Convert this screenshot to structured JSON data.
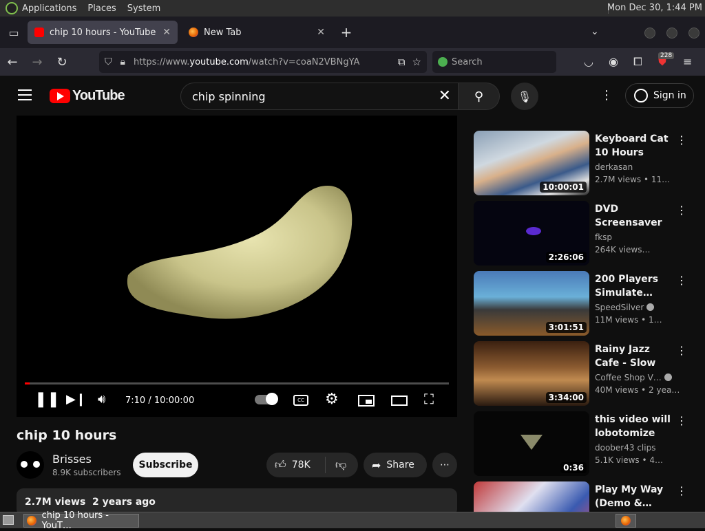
{
  "system_panel": {
    "menus": [
      "Applications",
      "Places",
      "System"
    ],
    "clock": "Mon Dec 30,  1:44 PM"
  },
  "browser": {
    "tabs": [
      {
        "title": "chip 10 hours - YouTube",
        "active": true
      },
      {
        "title": "New Tab",
        "active": false
      }
    ],
    "url_prefix": "https://www.",
    "url_domain": "youtube.com",
    "url_path": "/watch?v=coaN2VBNgYA",
    "search_placeholder": "Search",
    "extension_badge": "228"
  },
  "youtube": {
    "logo_text": "YouTube",
    "search_value": "chip spinning",
    "sign_in_label": "Sign in"
  },
  "player": {
    "time_display": "7:10 / 10:00:00",
    "progress_fraction": 0.0119
  },
  "video": {
    "title": "chip 10 hours",
    "channel": "Brisses",
    "subscribers": "8.9K subscribers",
    "subscribe_label": "Subscribe",
    "likes": "78K",
    "share_label": "Share",
    "description_stats": "2.7M views  2 years ago"
  },
  "recommendations": [
    {
      "title": "Keyboard Cat 10 Hours",
      "channel": "derkasan",
      "verified": false,
      "meta": "2.7M views  • 11…",
      "duration": "10:00:01",
      "thumb": "keyboard-cat"
    },
    {
      "title": "DVD Screensaver test",
      "channel": "fksp",
      "verified": false,
      "meta": "264K views…",
      "duration": "2:26:06",
      "thumb": "dvd"
    },
    {
      "title": "200 Players Simulate…",
      "channel": "SpeedSilver",
      "verified": true,
      "meta": "11M views  • 1…",
      "duration": "3:01:51",
      "thumb": "minecraft"
    },
    {
      "title": "Rainy Jazz Cafe - Slow Jazz Musi…",
      "channel": "Coffee Shop V…",
      "verified": true,
      "meta": "40M views  • 2 yea…",
      "duration": "3:34:00",
      "thumb": "cafe"
    },
    {
      "title": "this video will lobotomize you…",
      "channel": "doober43 clips",
      "verified": false,
      "meta": "5.1K views  • 4…",
      "duration": "0:36",
      "thumb": "dark-chip"
    },
    {
      "title": "Play My Way (Demo &…",
      "channel": "",
      "verified": false,
      "meta": "",
      "duration": "",
      "thumb": "play-my-way"
    }
  ],
  "taskbar": {
    "window_title": "chip 10 hours - YouT…"
  }
}
